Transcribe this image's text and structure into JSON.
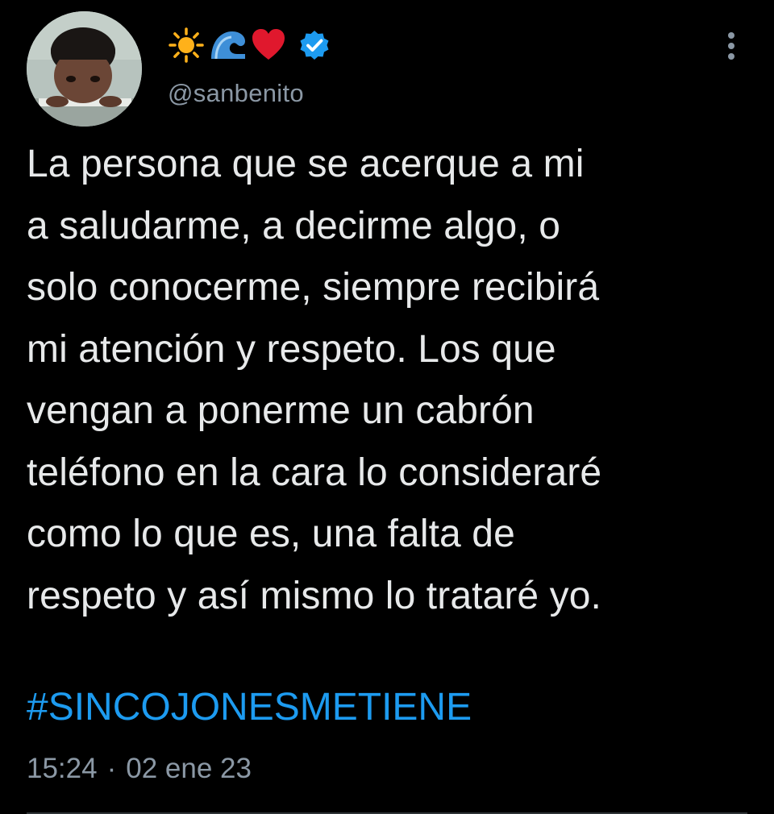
{
  "tweet": {
    "display_name_emojis": [
      "sun-icon",
      "wave-icon",
      "red-heart-icon"
    ],
    "verified": true,
    "handle": "@sanbenito",
    "text": "La persona que se acerque a mi\na saludarme, a decirme algo, o\nsolo conocerme, siempre recibirá\nmi atención y respeto. Los que\nvengan a ponerme un cabrón\nteléfono en la cara lo consideraré\ncomo lo que es, una falta de\nrespeto y así mismo lo trataré yo.",
    "hashtag": "#SINCOJONESMETIENE",
    "time": "15:24",
    "separator": "·",
    "date": "02 ene 23"
  },
  "colors": {
    "background": "#000000",
    "text": "#e7e9ea",
    "secondary_text": "#8b98a5",
    "link": "#1d9bf0",
    "verified_badge": "#1d9bf0",
    "heart": "#e0182d",
    "sun": "#ffb11a"
  }
}
